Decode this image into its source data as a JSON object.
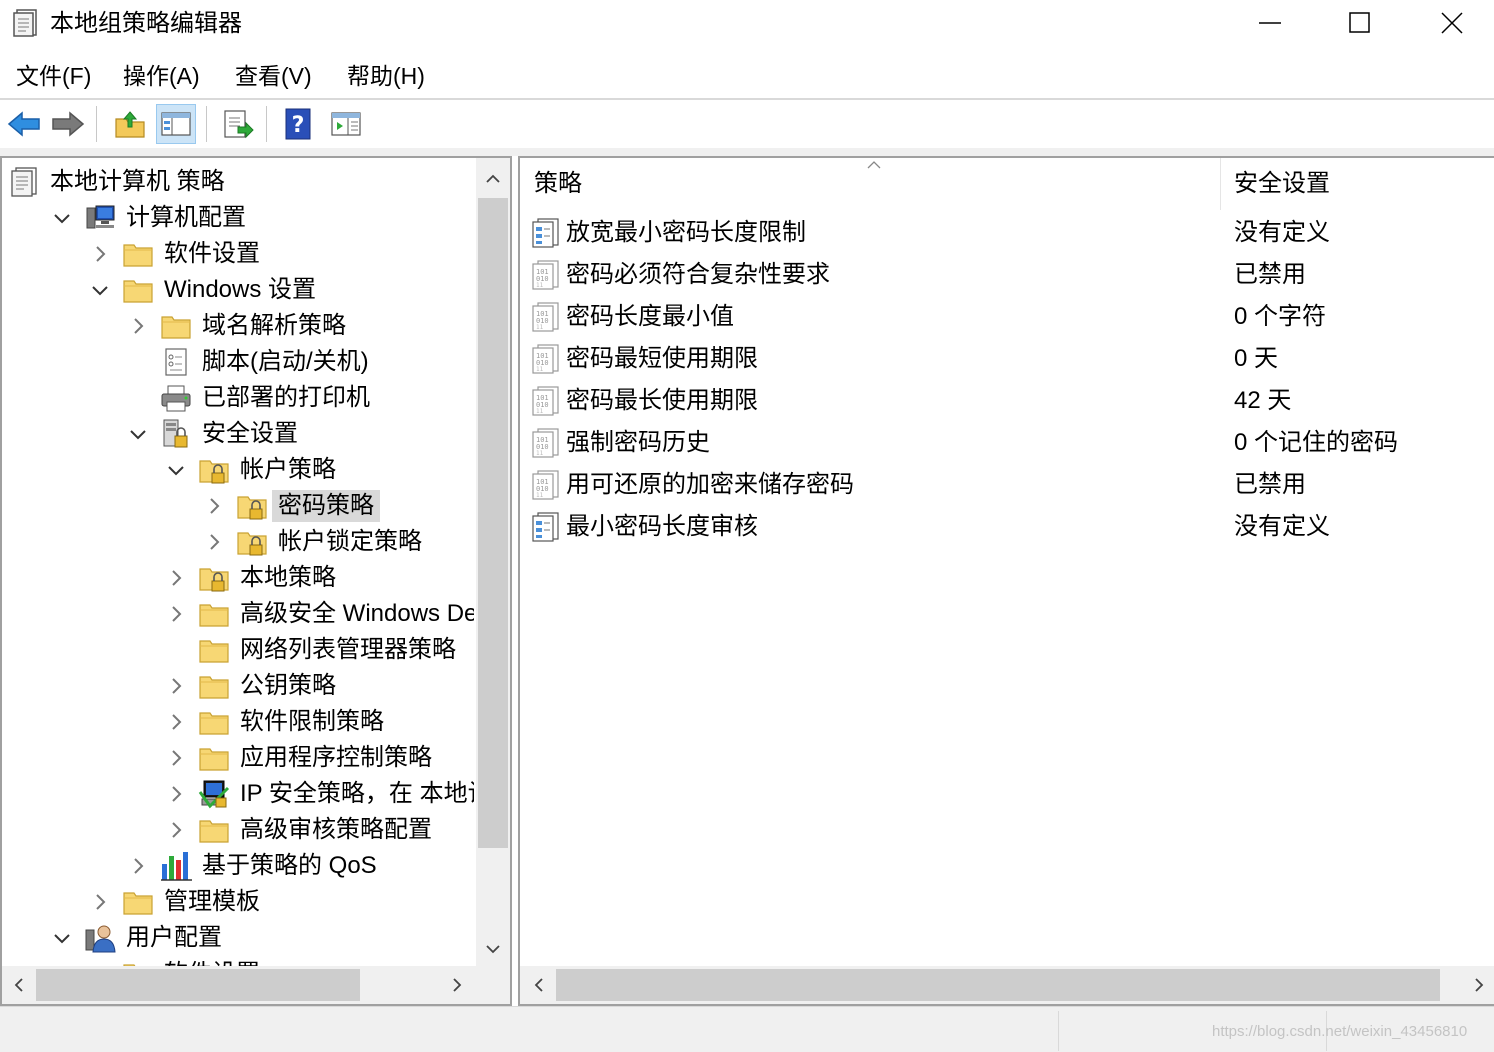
{
  "window": {
    "title": "本地组策略编辑器",
    "icon": "policy-doc-icon"
  },
  "menu": [
    "文件(F)",
    "操作(A)",
    "查看(V)",
    "帮助(H)"
  ],
  "toolbar": {
    "buttons": [
      "back-arrow-icon",
      "forward-arrow-icon",
      "up-folder-icon",
      "show-hide-tree-icon",
      "export-list-icon",
      "help-icon",
      "properties-pane-icon"
    ],
    "active": "show-hide-tree-icon"
  },
  "tree": {
    "items": [
      {
        "label": "本地计算机 策略",
        "icon": "policy-doc-icon",
        "expander": "none"
      },
      {
        "label": "计算机配置",
        "icon": "computer-icon",
        "expander": "expanded"
      },
      {
        "label": "软件设置",
        "icon": "folder-icon",
        "expander": "collapsed"
      },
      {
        "label": "Windows 设置",
        "icon": "folder-icon",
        "expander": "expanded"
      },
      {
        "label": "域名解析策略",
        "icon": "folder-icon",
        "expander": "collapsed"
      },
      {
        "label": "脚本(启动/关机)",
        "icon": "script-icon",
        "expander": "none"
      },
      {
        "label": "已部署的打印机",
        "icon": "printer-icon",
        "expander": "none"
      },
      {
        "label": "安全设置",
        "icon": "security-settings-icon",
        "expander": "expanded"
      },
      {
        "label": "帐户策略",
        "icon": "locked-folder-icon",
        "expander": "expanded"
      },
      {
        "label": "密码策略",
        "icon": "locked-folder-icon",
        "expander": "collapsed",
        "selected": true
      },
      {
        "label": "帐户锁定策略",
        "icon": "locked-folder-icon",
        "expander": "collapsed"
      },
      {
        "label": "本地策略",
        "icon": "locked-folder-icon",
        "expander": "collapsed"
      },
      {
        "label": "高级安全 Windows Defen",
        "icon": "folder-icon",
        "expander": "collapsed"
      },
      {
        "label": "网络列表管理器策略",
        "icon": "folder-icon",
        "expander": "none"
      },
      {
        "label": "公钥策略",
        "icon": "folder-icon",
        "expander": "collapsed"
      },
      {
        "label": "软件限制策略",
        "icon": "folder-icon",
        "expander": "collapsed"
      },
      {
        "label": "应用程序控制策略",
        "icon": "folder-icon",
        "expander": "collapsed"
      },
      {
        "label": "IP 安全策略，在 本地计算机",
        "icon": "ip-security-icon",
        "expander": "collapsed"
      },
      {
        "label": "高级审核策略配置",
        "icon": "folder-icon",
        "expander": "collapsed"
      },
      {
        "label": "基于策略的 QoS",
        "icon": "qos-chart-icon",
        "expander": "collapsed"
      },
      {
        "label": "管理模板",
        "icon": "folder-icon",
        "expander": "collapsed"
      },
      {
        "label": "用户配置",
        "icon": "user-icon",
        "expander": "expanded"
      },
      {
        "label": "软件设置",
        "icon": "folder-icon",
        "expander": "collapsed"
      }
    ]
  },
  "list": {
    "columns": [
      "策略",
      "安全设置"
    ],
    "rows": [
      {
        "policy": "放宽最小密码长度限制",
        "setting": "没有定义",
        "icon": "policy-setting-icon"
      },
      {
        "policy": "密码必须符合复杂性要求",
        "setting": "已禁用",
        "icon": "policy-binary-icon"
      },
      {
        "policy": "密码长度最小值",
        "setting": "0 个字符",
        "icon": "policy-binary-icon"
      },
      {
        "policy": "密码最短使用期限",
        "setting": "0 天",
        "icon": "policy-binary-icon"
      },
      {
        "policy": "密码最长使用期限",
        "setting": "42 天",
        "icon": "policy-binary-icon"
      },
      {
        "policy": "强制密码历史",
        "setting": "0 个记住的密码",
        "icon": "policy-binary-icon"
      },
      {
        "policy": "用可还原的加密来储存密码",
        "setting": "已禁用",
        "icon": "policy-binary-icon"
      },
      {
        "policy": "最小密码长度审核",
        "setting": "没有定义",
        "icon": "policy-setting-icon"
      }
    ]
  },
  "status": {
    "watermark": "https://blog.csdn.net/weixin_43456810"
  }
}
